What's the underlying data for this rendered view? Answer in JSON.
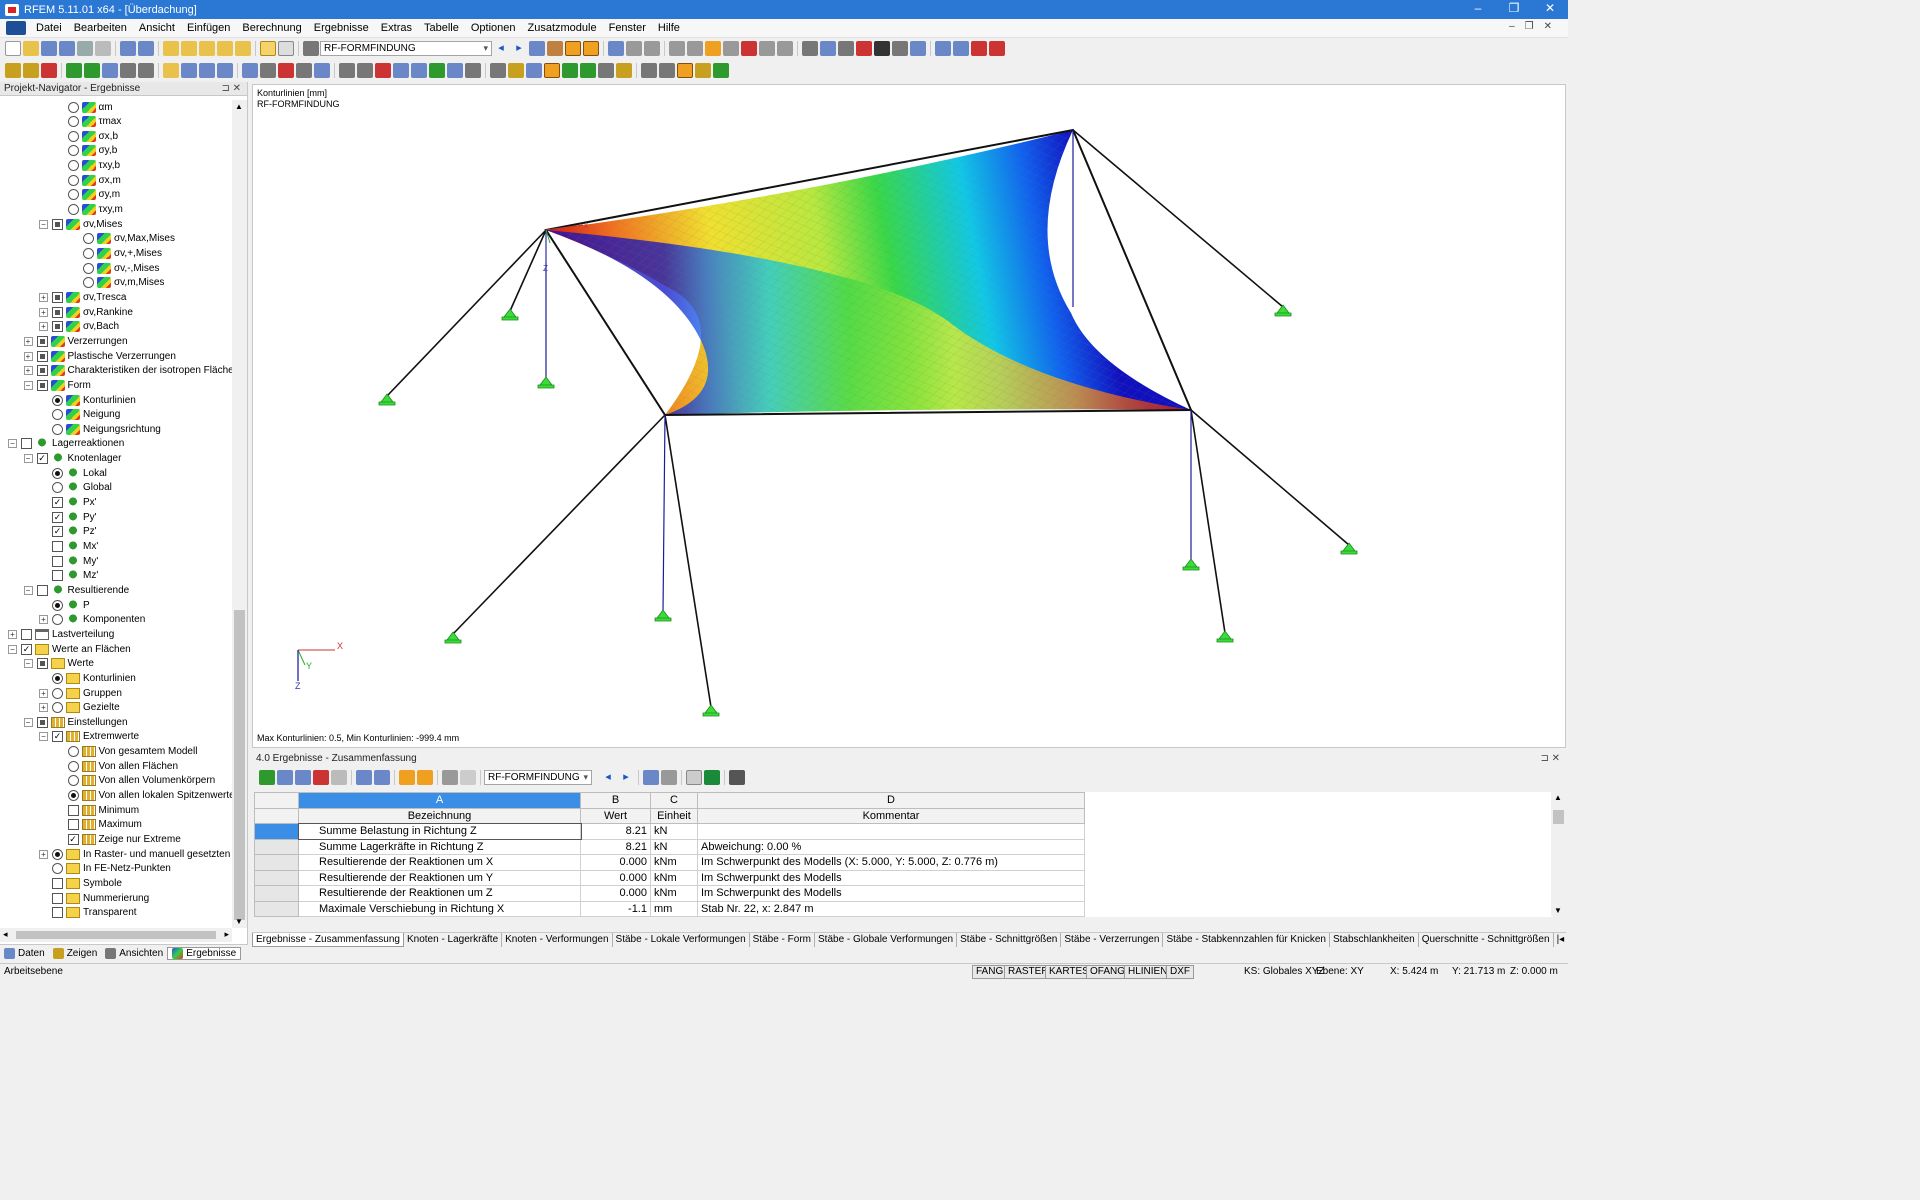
{
  "window": {
    "title": "RFEM 5.11.01 x64 - [Überdachung]",
    "min": "–",
    "max": "❐",
    "close": "✕"
  },
  "menu": [
    "Datei",
    "Bearbeiten",
    "Ansicht",
    "Einfügen",
    "Berechnung",
    "Ergebnisse",
    "Extras",
    "Tabelle",
    "Optionen",
    "Zusatzmodule",
    "Fenster",
    "Hilfe"
  ],
  "toolbar": {
    "case_select": "RF-FORMFINDUNG"
  },
  "navigator": {
    "title": "Projekt-Navigator - Ergebnisse",
    "items": [
      {
        "d": 3,
        "e": "",
        "c": "r0",
        "i": "res",
        "t": "αm"
      },
      {
        "d": 3,
        "e": "",
        "c": "r0",
        "i": "res",
        "t": "τmax"
      },
      {
        "d": 3,
        "e": "",
        "c": "r0",
        "i": "res",
        "t": "σx,b"
      },
      {
        "d": 3,
        "e": "",
        "c": "r0",
        "i": "res",
        "t": "σy,b"
      },
      {
        "d": 3,
        "e": "",
        "c": "r0",
        "i": "res",
        "t": "τxy,b"
      },
      {
        "d": 3,
        "e": "",
        "c": "r0",
        "i": "res",
        "t": "σx,m"
      },
      {
        "d": 3,
        "e": "",
        "c": "r0",
        "i": "res",
        "t": "σy,m"
      },
      {
        "d": 3,
        "e": "",
        "c": "r0",
        "i": "res",
        "t": "τxy,m"
      },
      {
        "d": 2,
        "e": "−",
        "c": "cp",
        "i": "res",
        "t": "σv,Mises"
      },
      {
        "d": 4,
        "e": "",
        "c": "r0",
        "i": "res",
        "t": "σv,Max,Mises"
      },
      {
        "d": 4,
        "e": "",
        "c": "r0",
        "i": "res",
        "t": "σv,+,Mises"
      },
      {
        "d": 4,
        "e": "",
        "c": "r0",
        "i": "res",
        "t": "σv,-,Mises"
      },
      {
        "d": 4,
        "e": "",
        "c": "r0",
        "i": "res",
        "t": "σv,m,Mises"
      },
      {
        "d": 2,
        "e": "+",
        "c": "cp",
        "i": "res",
        "t": "σv,Tresca"
      },
      {
        "d": 2,
        "e": "+",
        "c": "cp",
        "i": "res",
        "t": "σv,Rankine"
      },
      {
        "d": 2,
        "e": "+",
        "c": "cp",
        "i": "res",
        "t": "σv,Bach"
      },
      {
        "d": 1,
        "e": "+",
        "c": "cp",
        "i": "res",
        "t": "Verzerrungen"
      },
      {
        "d": 1,
        "e": "+",
        "c": "cp",
        "i": "res",
        "t": "Plastische Verzerrungen"
      },
      {
        "d": 1,
        "e": "+",
        "c": "cp",
        "i": "res",
        "t": "Charakteristiken der isotropen Fläche"
      },
      {
        "d": 1,
        "e": "−",
        "c": "cp",
        "i": "res",
        "t": "Form"
      },
      {
        "d": 2,
        "e": "",
        "c": "r1",
        "i": "res",
        "t": "Konturlinien"
      },
      {
        "d": 2,
        "e": "",
        "c": "r0",
        "i": "res",
        "t": "Neigung"
      },
      {
        "d": 2,
        "e": "",
        "c": "r0",
        "i": "res",
        "t": "Neigungsrichtung"
      },
      {
        "d": 0,
        "e": "−",
        "c": "c0",
        "i": "sup",
        "t": "Lagerreaktionen"
      },
      {
        "d": 1,
        "e": "−",
        "c": "c1",
        "i": "sup",
        "t": "Knotenlager"
      },
      {
        "d": 2,
        "e": "",
        "c": "r1",
        "i": "sup",
        "t": "Lokal"
      },
      {
        "d": 2,
        "e": "",
        "c": "r0",
        "i": "sup",
        "t": "Global"
      },
      {
        "d": 2,
        "e": "",
        "c": "c1",
        "i": "sup",
        "t": "Px'"
      },
      {
        "d": 2,
        "e": "",
        "c": "c1",
        "i": "sup",
        "t": "Py'"
      },
      {
        "d": 2,
        "e": "",
        "c": "c1",
        "i": "sup",
        "t": "Pz'"
      },
      {
        "d": 2,
        "e": "",
        "c": "c0",
        "i": "sup",
        "t": "Mx'"
      },
      {
        "d": 2,
        "e": "",
        "c": "c0",
        "i": "sup",
        "t": "My'"
      },
      {
        "d": 2,
        "e": "",
        "c": "c0",
        "i": "sup",
        "t": "Mz'"
      },
      {
        "d": 1,
        "e": "−",
        "c": "c0",
        "i": "sup",
        "t": "Resultierende"
      },
      {
        "d": 2,
        "e": "",
        "c": "r1",
        "i": "sup",
        "t": "P"
      },
      {
        "d": 2,
        "e": "+",
        "c": "r0",
        "i": "sup",
        "t": "Komponenten"
      },
      {
        "d": 0,
        "e": "+",
        "c": "c0",
        "i": "lv",
        "t": "Lastverteilung"
      },
      {
        "d": 0,
        "e": "−",
        "c": "c1",
        "i": "val",
        "t": "Werte an Flächen"
      },
      {
        "d": 1,
        "e": "−",
        "c": "cp",
        "i": "val",
        "t": "Werte"
      },
      {
        "d": 2,
        "e": "",
        "c": "r1",
        "i": "val",
        "t": "Konturlinien"
      },
      {
        "d": 2,
        "e": "+",
        "c": "r0",
        "i": "val",
        "t": "Gruppen"
      },
      {
        "d": 2,
        "e": "+",
        "c": "r0",
        "i": "val",
        "t": "Gezielte"
      },
      {
        "d": 1,
        "e": "−",
        "c": "cp",
        "i": "cfg",
        "t": "Einstellungen"
      },
      {
        "d": 2,
        "e": "−",
        "c": "c1",
        "i": "cfg",
        "t": "Extremwerte"
      },
      {
        "d": 3,
        "e": "",
        "c": "r0",
        "i": "cfg",
        "t": "Von gesamtem Modell"
      },
      {
        "d": 3,
        "e": "",
        "c": "r0",
        "i": "cfg",
        "t": "Von allen Flächen"
      },
      {
        "d": 3,
        "e": "",
        "c": "r0",
        "i": "cfg",
        "t": "Von allen Volumenkörpern"
      },
      {
        "d": 3,
        "e": "",
        "c": "r1",
        "i": "cfg",
        "t": "Von allen lokalen Spitzenwerten"
      },
      {
        "d": 3,
        "e": "",
        "c": "c0",
        "i": "cfg",
        "t": "Minimum"
      },
      {
        "d": 3,
        "e": "",
        "c": "c0",
        "i": "cfg",
        "t": "Maximum"
      },
      {
        "d": 3,
        "e": "",
        "c": "c1",
        "i": "cfg",
        "t": "Zeige nur Extreme"
      },
      {
        "d": 2,
        "e": "+",
        "c": "r1",
        "i": "val",
        "t": "In Raster- und manuell gesetzten P"
      },
      {
        "d": 2,
        "e": "",
        "c": "r0",
        "i": "val",
        "t": "In FE-Netz-Punkten"
      },
      {
        "d": 2,
        "e": "",
        "c": "c0",
        "i": "val",
        "t": "Symbole"
      },
      {
        "d": 2,
        "e": "",
        "c": "c0",
        "i": "val",
        "t": "Nummerierung"
      },
      {
        "d": 2,
        "e": "",
        "c": "c0",
        "i": "val",
        "t": "Transparent"
      }
    ],
    "tabs": [
      "Daten",
      "Zeigen",
      "Ansichten",
      "Ergebnisse"
    ]
  },
  "viewport": {
    "label1": "Konturlinien [mm]",
    "label2": "RF-FORMFINDUNG",
    "footer": "Max Konturlinien: 0.5, Min Konturlinien: -999.4 mm",
    "axis_x": "X",
    "axis_y": "Y",
    "axis_z": "Z",
    "node_axis": "Z"
  },
  "results": {
    "title": "4.0 Ergebnisse - Zusammenfassung",
    "case_select": "RF-FORMFINDUNG",
    "col_letters": [
      "A",
      "B",
      "C",
      "D"
    ],
    "headers": [
      "Bezeichnung",
      "Wert",
      "Einheit",
      "Kommentar"
    ],
    "rows": [
      [
        "Summe Belastung in Richtung Z",
        "8.21",
        "kN",
        ""
      ],
      [
        "Summe Lagerkräfte in Richtung Z",
        "8.21",
        "kN",
        "Abweichung:  0.00 %"
      ],
      [
        "Resultierende der Reaktionen um X",
        "0.000",
        "kNm",
        "Im Schwerpunkt des Modells (X: 5.000, Y: 5.000, Z: 0.776 m)"
      ],
      [
        "Resultierende der Reaktionen um Y",
        "0.000",
        "kNm",
        "Im Schwerpunkt des Modells"
      ],
      [
        "Resultierende der Reaktionen um Z",
        "0.000",
        "kNm",
        "Im Schwerpunkt des Modells"
      ],
      [
        "Maximale Verschiebung in Richtung X",
        "-1.1",
        "mm",
        "Stab Nr. 22,  x: 2.847 m"
      ]
    ],
    "tabs": [
      "Ergebnisse - Zusammenfassung",
      "Knoten - Lagerkräfte",
      "Knoten - Verformungen",
      "Stäbe - Lokale Verformungen",
      "Stäbe - Form",
      "Stäbe - Globale Verformungen",
      "Stäbe - Schnittgrößen",
      "Stäbe - Verzerrungen",
      "Stäbe - Stabkennzahlen für Knicken",
      "Stabschlankheiten",
      "Querschnitte - Schnittgrößen"
    ]
  },
  "status": {
    "left": "Arbeitsebene",
    "buttons": [
      "FANG",
      "RASTER",
      "KARTES",
      "OFANG",
      "HLINIEN",
      "DXF"
    ],
    "ks": "KS: Globales XYZ",
    "plane": "Ebene: XY",
    "x": "X:  5.424 m",
    "y": "Y:  21.713 m",
    "z": "Z:  0.000 m"
  }
}
